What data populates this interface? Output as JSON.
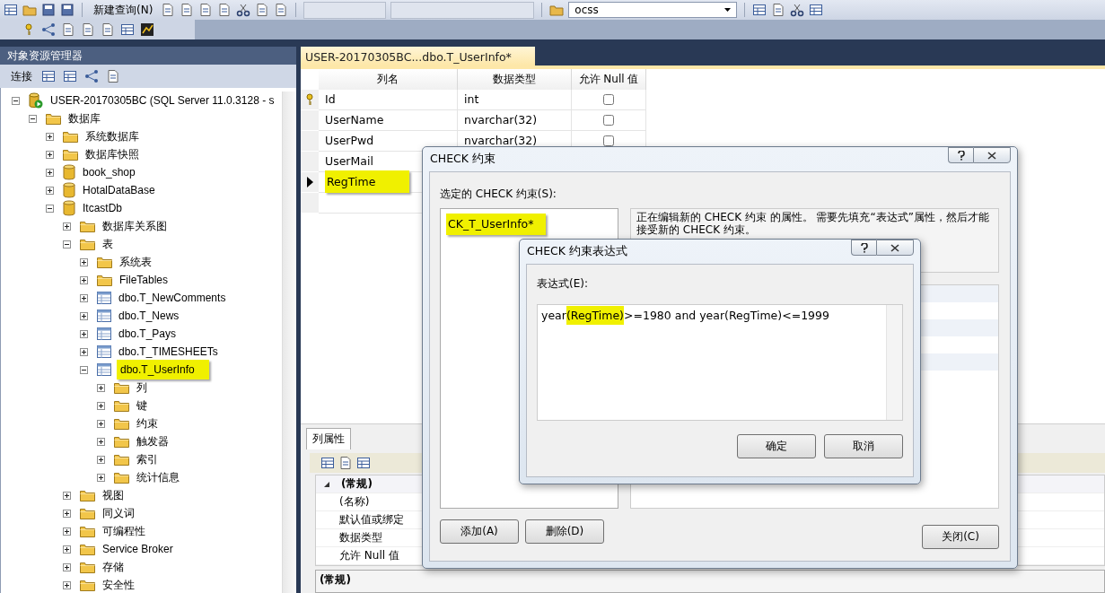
{
  "toolbar": {
    "query_button": "新建查询(N)",
    "database_select": "ocss"
  },
  "object_explorer": {
    "title": "对象资源管理器",
    "connect_button": "连接",
    "tree": [
      {
        "label": "USER-20170305BC (SQL Server 11.0.3128 - s",
        "kind": "server",
        "expanded": true,
        "highlight": false,
        "children": [
          {
            "label": "数据库",
            "kind": "folder",
            "expanded": true,
            "highlight": false,
            "children": [
              {
                "label": "系统数据库",
                "kind": "folder",
                "expanded": false,
                "highlight": false
              },
              {
                "label": "数据库快照",
                "kind": "folder",
                "expanded": false,
                "highlight": false
              },
              {
                "label": "book_shop",
                "kind": "database",
                "expanded": false,
                "highlight": false
              },
              {
                "label": "HotalDataBase",
                "kind": "database",
                "expanded": false,
                "highlight": false
              },
              {
                "label": "ItcastDb",
                "kind": "database",
                "expanded": true,
                "highlight": false,
                "children": [
                  {
                    "label": "数据库关系图",
                    "kind": "folder",
                    "expanded": false,
                    "highlight": false
                  },
                  {
                    "label": "表",
                    "kind": "folder",
                    "expanded": true,
                    "highlight": false,
                    "children": [
                      {
                        "label": "系统表",
                        "kind": "folder",
                        "expanded": false,
                        "highlight": false
                      },
                      {
                        "label": "FileTables",
                        "kind": "folder",
                        "expanded": false,
                        "highlight": false
                      },
                      {
                        "label": "dbo.T_NewComments",
                        "kind": "table",
                        "expanded": false,
                        "highlight": false
                      },
                      {
                        "label": "dbo.T_News",
                        "kind": "table",
                        "expanded": false,
                        "highlight": false
                      },
                      {
                        "label": "dbo.T_Pays",
                        "kind": "table",
                        "expanded": false,
                        "highlight": false
                      },
                      {
                        "label": "dbo.T_TIMESHEETs",
                        "kind": "table",
                        "expanded": false,
                        "highlight": false
                      },
                      {
                        "label": "dbo.T_UserInfo",
                        "kind": "table",
                        "expanded": true,
                        "highlight": true,
                        "children": [
                          {
                            "label": "列",
                            "kind": "folder",
                            "expanded": false,
                            "highlight": false
                          },
                          {
                            "label": "键",
                            "kind": "folder",
                            "expanded": false,
                            "highlight": false
                          },
                          {
                            "label": "约束",
                            "kind": "folder",
                            "expanded": false,
                            "highlight": false
                          },
                          {
                            "label": "触发器",
                            "kind": "folder",
                            "expanded": false,
                            "highlight": false
                          },
                          {
                            "label": "索引",
                            "kind": "folder",
                            "expanded": false,
                            "highlight": false
                          },
                          {
                            "label": "统计信息",
                            "kind": "folder",
                            "expanded": false,
                            "highlight": false
                          }
                        ]
                      }
                    ]
                  },
                  {
                    "label": "视图",
                    "kind": "folder",
                    "expanded": false,
                    "highlight": false
                  },
                  {
                    "label": "同义词",
                    "kind": "folder",
                    "expanded": false,
                    "highlight": false
                  },
                  {
                    "label": "可编程性",
                    "kind": "folder",
                    "expanded": false,
                    "highlight": false
                  },
                  {
                    "label": "Service Broker",
                    "kind": "folder",
                    "expanded": false,
                    "highlight": false
                  },
                  {
                    "label": "存储",
                    "kind": "folder",
                    "expanded": false,
                    "highlight": false
                  },
                  {
                    "label": "安全性",
                    "kind": "folder",
                    "expanded": false,
                    "highlight": false
                  }
                ]
              }
            ]
          }
        ]
      }
    ]
  },
  "document_tab": {
    "title": "USER-20170305BC...dbo.T_UserInfo*",
    "selected": true
  },
  "designer": {
    "columns": [
      "列名",
      "数据类型",
      "允许 Null 值"
    ],
    "rows": [
      {
        "name": "Id",
        "type": "int",
        "allow_null": false,
        "primary_key": true,
        "current": false,
        "highlight": false
      },
      {
        "name": "UserName",
        "type": "nvarchar(32)",
        "allow_null": false,
        "primary_key": false,
        "current": false,
        "highlight": false
      },
      {
        "name": "UserPwd",
        "type": "nvarchar(32)",
        "allow_null": false,
        "primary_key": false,
        "current": false,
        "highlight": false
      },
      {
        "name": "UserMail",
        "primary_key": false,
        "current": false,
        "highlight": false
      },
      {
        "name": "RegTime",
        "primary_key": false,
        "current": true,
        "highlight": true
      }
    ]
  },
  "column_properties": {
    "tab": "列属性",
    "categories": [
      {
        "label": "(常规)",
        "expanded": true,
        "properties": [
          "(名称)",
          "默认值或绑定",
          "数据类型",
          "允许 Null 值"
        ]
      }
    ],
    "description_title": "(常规)"
  },
  "check_dialog": {
    "title": "CHECK 约束",
    "list_label": "选定的 CHECK 约束(S):",
    "constraints": [
      {
        "name": "CK_T_UserInfo*",
        "highlight": true
      }
    ],
    "description": "正在编辑新的 CHECK 约束 的属性。  需要先填充“表达式”属性，然后才能接受新的 CHECK 约束。",
    "buttons": [
      "添加(A)",
      "删除(D)"
    ],
    "close_button": "关闭(C)"
  },
  "expression_dialog": {
    "title": "CHECK 约束表达式",
    "label": "表达式(E):",
    "expression": [
      {
        "text": "year",
        "highlight": false
      },
      {
        "text": "(RegTime)",
        "highlight": true
      },
      {
        "text": ">=1980 and year(RegTime)<=1999",
        "highlight": false
      }
    ],
    "buttons": [
      "确定",
      "取消"
    ]
  }
}
